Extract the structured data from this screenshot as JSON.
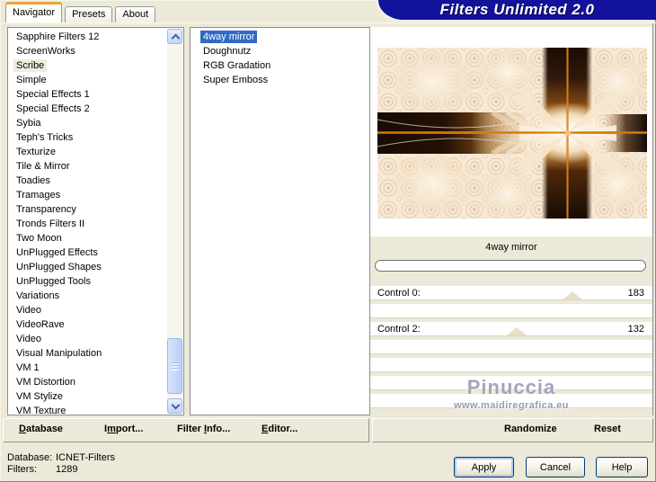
{
  "window": {
    "title": "Filters Unlimited 2.0"
  },
  "tabs": [
    {
      "label": "Navigator",
      "active": true
    },
    {
      "label": "Presets",
      "active": false
    },
    {
      "label": "About",
      "active": false
    }
  ],
  "category_list": {
    "selected": "Scribe",
    "items": [
      "Sapphire Filters 12",
      "ScreenWorks",
      "Scribe",
      "Simple",
      "Special Effects 1",
      "Special Effects 2",
      "Sybia",
      "Teph's Tricks",
      "Texturize",
      "Tile & Mirror",
      "Toadies",
      "Tramages",
      "Transparency",
      "Tronds Filters II",
      "Two Moon",
      "UnPlugged Effects",
      "UnPlugged Shapes",
      "UnPlugged Tools",
      "Variations",
      "Video",
      "VideoRave",
      "Video",
      "Visual Manipulation",
      "VM 1",
      "VM Distortion",
      "VM Stylize",
      "VM Texture"
    ]
  },
  "filter_list": {
    "selected": "4way mirror",
    "items": [
      "4way mirror",
      "Doughnutz",
      "RGB Gradation",
      "Super Emboss"
    ]
  },
  "preview": {
    "caption": "4way mirror",
    "progress_percent": 0
  },
  "controls": [
    {
      "label": "Control 0:",
      "value": 183,
      "percent": 71.8
    },
    {
      "label": "Control 2:",
      "value": 132,
      "percent": 51.8
    }
  ],
  "watermark": {
    "name": "Pinuccia",
    "url": "www.maidiregrafica.eu"
  },
  "toolbar": {
    "database": {
      "pre": "",
      "accel": "D",
      "post": "atabase"
    },
    "import": {
      "pre": "I",
      "accel": "m",
      "post": "port..."
    },
    "filter_info": {
      "pre": "Filter ",
      "accel": "I",
      "post": "nfo..."
    },
    "editor": {
      "pre": "",
      "accel": "E",
      "post": "ditor..."
    },
    "randomize": "Randomize",
    "reset": "Reset"
  },
  "status": {
    "database_label": "Database:",
    "database_value": "ICNET-Filters",
    "filters_label": "Filters:",
    "filters_value": "1289"
  },
  "actions": {
    "apply": "Apply",
    "cancel": "Cancel",
    "help": "Help"
  },
  "colors": {
    "banner_blue": "#12129B",
    "selection_blue": "#316AC5",
    "dialog_beige": "#ECE9D8",
    "category_highlight": "#F0EDDE",
    "preview_orange": "#E08A1A",
    "preview_dark_brown": "#241106"
  }
}
